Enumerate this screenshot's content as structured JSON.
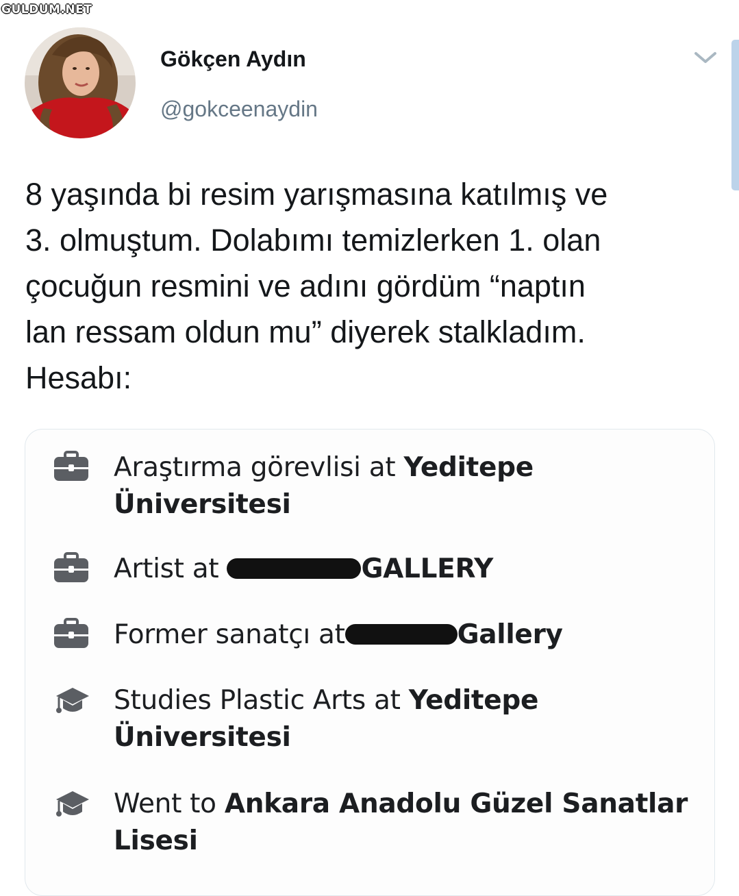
{
  "watermark": "GULDUM.NET",
  "tweet": {
    "display_name": "Gökçen Aydın",
    "handle": "@gokceenaydin",
    "text": "8 yaşında bi resim yarışmasına katılmış ve\n3. olmuştum. Dolabımı temizlerken 1. olan\nçocuğun resmini ve adını gördüm “naptın\nlan ressam oldun mu” diyerek stalkladım.\nHesabı:"
  },
  "icons": {
    "menu": "chevron-down-icon",
    "work": "briefcase-icon",
    "education": "graduation-cap-icon"
  },
  "profile_card": {
    "items": [
      {
        "type": "work",
        "prefix": "Araştırma görevlisi at ",
        "org": "Yeditepe Üniversitesi"
      },
      {
        "type": "work",
        "prefix": "Artist at ",
        "org": "GALLERY"
      },
      {
        "type": "work",
        "prefix": "Former sanatçı at",
        "org": "Gallery"
      },
      {
        "type": "education",
        "prefix": "Studies Plastic Arts at ",
        "org": "Yeditepe Üniversitesi"
      },
      {
        "type": "education",
        "prefix": "Went to ",
        "org": "Ankara Anadolu Güzel Sanatlar Lisesi"
      }
    ]
  },
  "colors": {
    "text_primary": "#14171a",
    "text_secondary": "#657786",
    "card_border": "#e1e8ed",
    "redaction": "#111111"
  }
}
